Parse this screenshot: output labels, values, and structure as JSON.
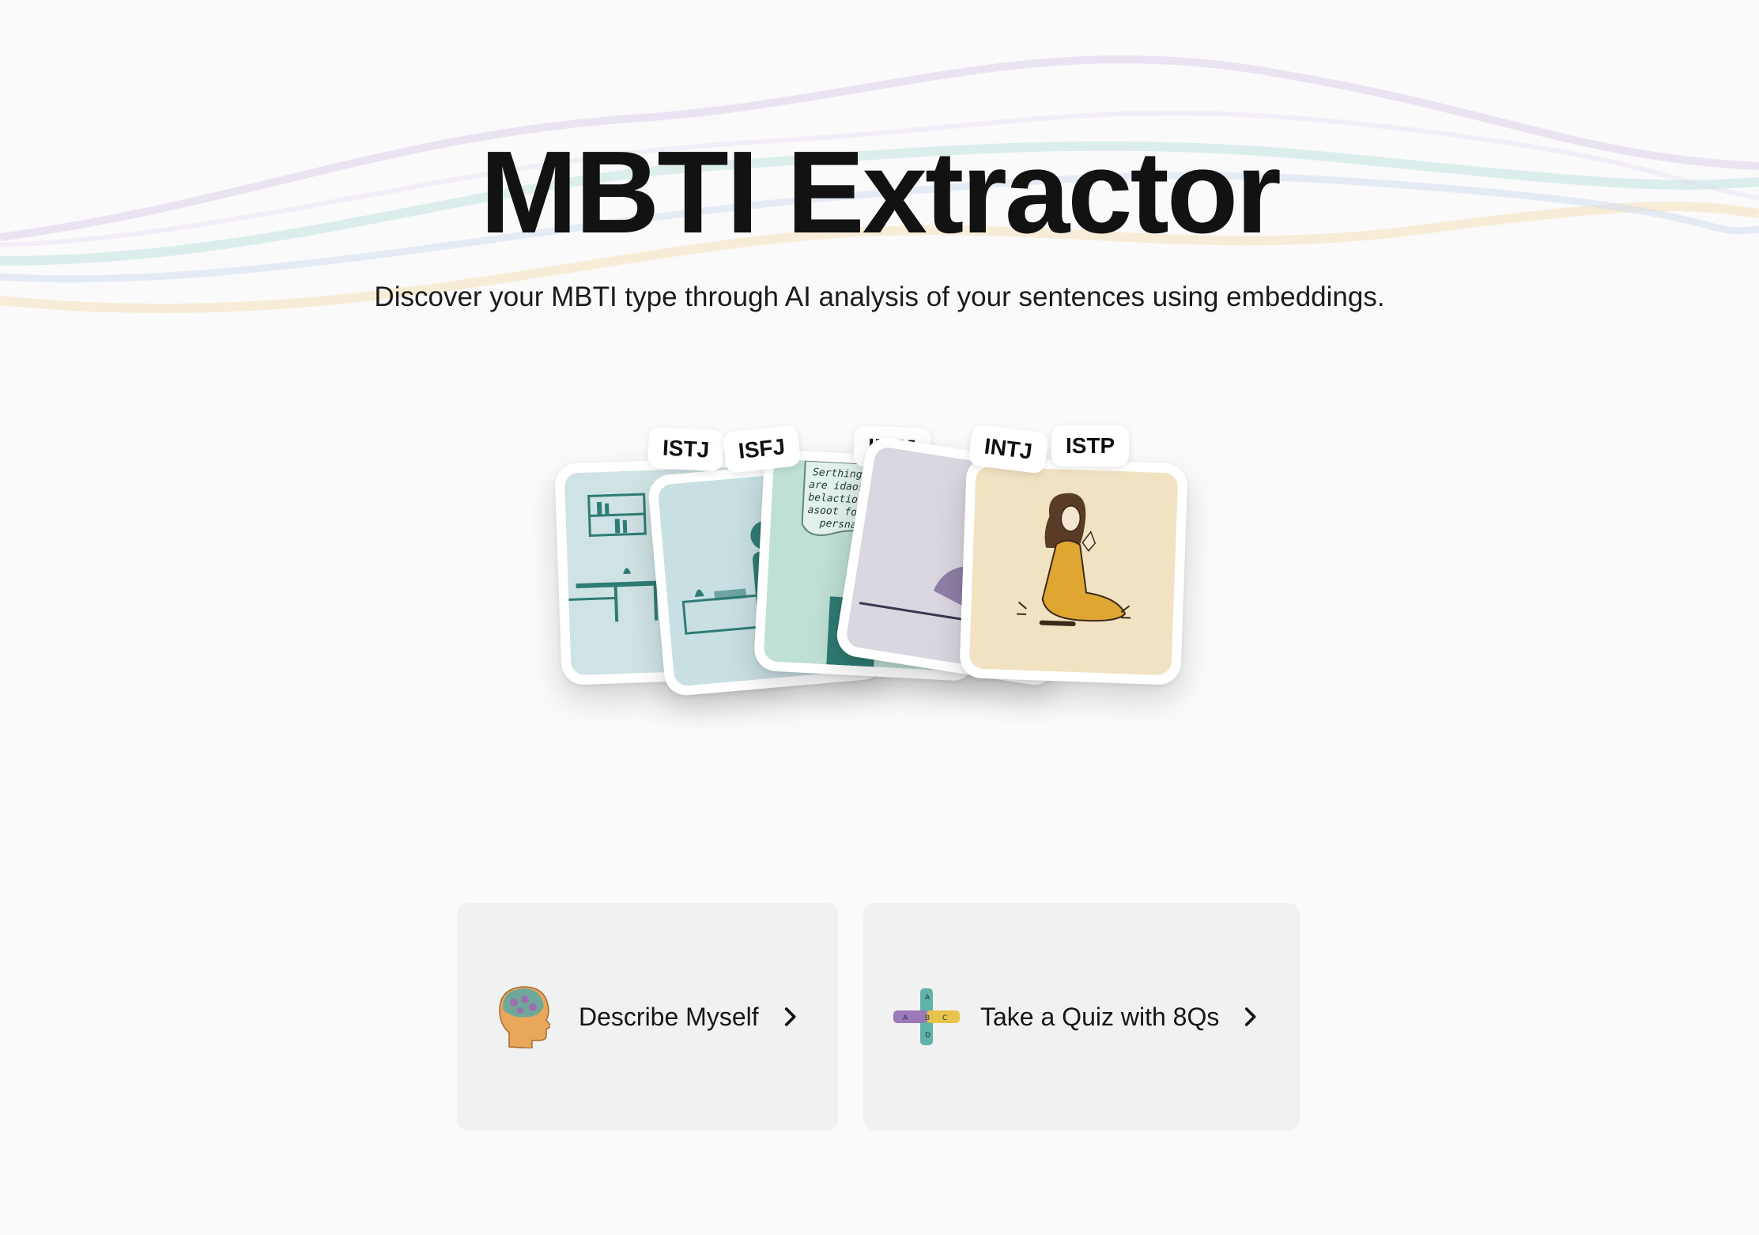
{
  "header": {
    "title": "MBTI Extractor",
    "subtitle": "Discover your MBTI type through AI analysis of your sentences using embeddings."
  },
  "cards": [
    {
      "type": "ISTJ",
      "illustration": "office-desk-scene",
      "color": "#cfe2e4"
    },
    {
      "type": "ISFJ",
      "illustration": "office-person-scene",
      "color": "#c9e0e3"
    },
    {
      "type": "INFJ",
      "illustration": "person-with-thought-bubble",
      "color": "#bfe0d6"
    },
    {
      "type": "INTJ",
      "illustration": "person-at-desk-lilac",
      "color": "#dad7e0"
    },
    {
      "type": "ISTP",
      "illustration": "woman-kneeling-meditating",
      "color": "#f1e3c1"
    }
  ],
  "bubble_text": [
    "Serthing p",
    "are idaos",
    "belactions",
    "asoot for",
    "persnal"
  ],
  "actions": [
    {
      "label": "Describe Myself",
      "icon": "brain-head-icon"
    },
    {
      "label": "Take a Quiz with 8Qs",
      "icon": "quiz-cross-icon"
    }
  ],
  "colors": {
    "button_bg": "#f1f1f1",
    "wave_purple": "#d7c8e6",
    "wave_teal": "#bfe3df",
    "wave_yellow": "#f4e2b8",
    "wave_blue": "#cbd9ee"
  }
}
